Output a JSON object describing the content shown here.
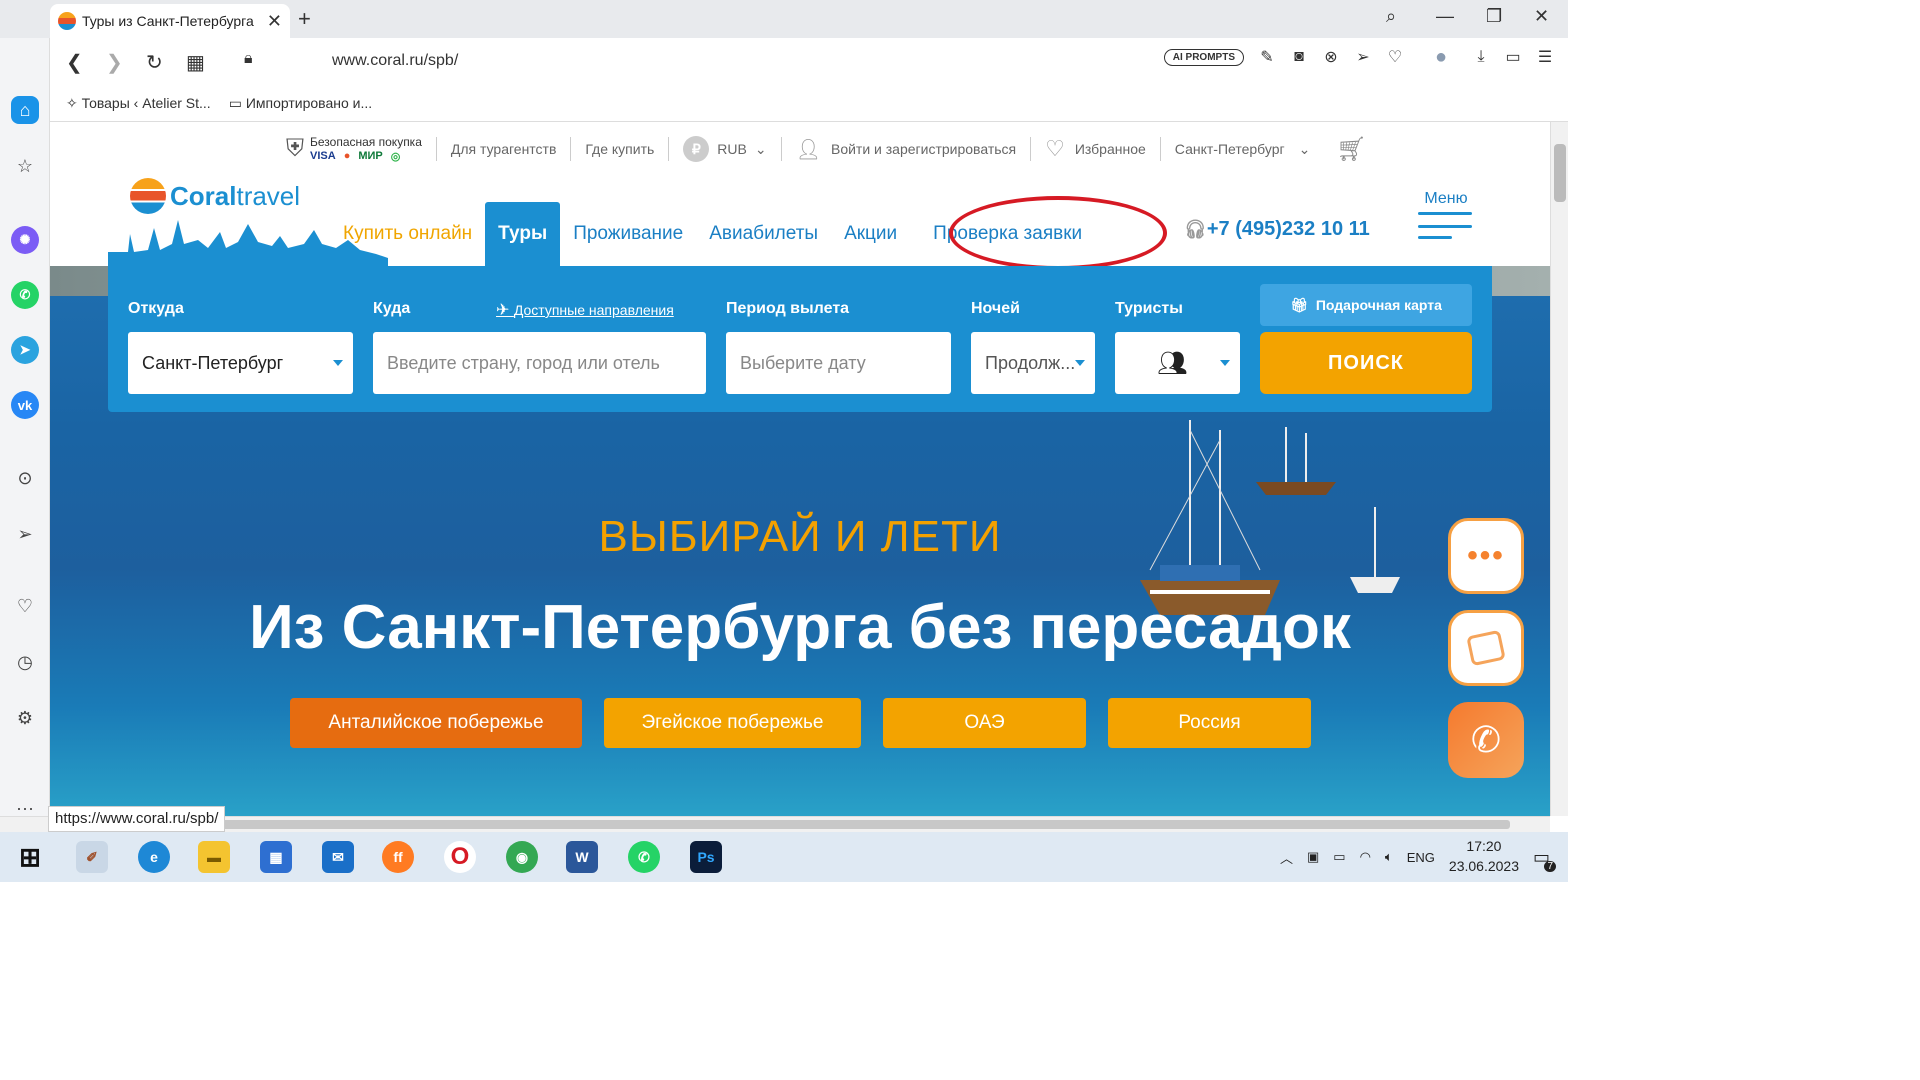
{
  "browser": {
    "tab_title": "Туры из Санкт-Петербурга",
    "url": "www.coral.ru/spb/",
    "ai_prompts": "AI PROMPTS",
    "bookmarks": [
      "Товары ‹ Atelier St...",
      "Импортировано и..."
    ],
    "status_url": "https://www.coral.ru/spb/"
  },
  "site": {
    "secure": {
      "label": "Безопасная покупка",
      "cards": [
        "VISA",
        "●",
        "МИР",
        "◎"
      ]
    },
    "topnav": [
      "Для турагентств",
      "Где купить",
      "RUB",
      "Войти и зарегистрироваться",
      "Избранное",
      "Санкт-Петербург"
    ],
    "logo": {
      "part1": "Coral",
      "part2": "travel"
    },
    "menu": [
      "Купить онлайн",
      "Туры",
      "Проживание",
      "Авиабилеты",
      "Акции",
      "Проверка заявки"
    ],
    "phone": "+7 (495)232 10 11",
    "menu_label": "Меню",
    "search": {
      "from_label": "Откуда",
      "from_value": "Санкт-Петербург",
      "to_label": "Куда",
      "available": "Доступные направления",
      "to_placeholder": "Введите страну, город или отель",
      "period_label": "Период вылета",
      "period_placeholder": "Выберите дату",
      "nights_label": "Ночей",
      "nights_value": "Продолж...",
      "tourists_label": "Туристы",
      "gift": "Подарочная карта",
      "search_button": "ПОИСК"
    },
    "hero": {
      "eyebrow": "ВЫБИРАЙ И ЛЕТИ",
      "headline": "Из Санкт-Петербурга без пересадок",
      "pills": [
        "Анталийское побережье",
        "Эгейское побережье",
        "ОАЭ",
        "Россия"
      ]
    }
  },
  "taskbar": {
    "lang": "ENG",
    "time": "17:20",
    "date": "23.06.2023",
    "notifications": "7"
  },
  "colors": {
    "brand_blue": "#1b8fd1",
    "brand_orange": "#f3a300",
    "highlight_red": "#d61a24"
  }
}
